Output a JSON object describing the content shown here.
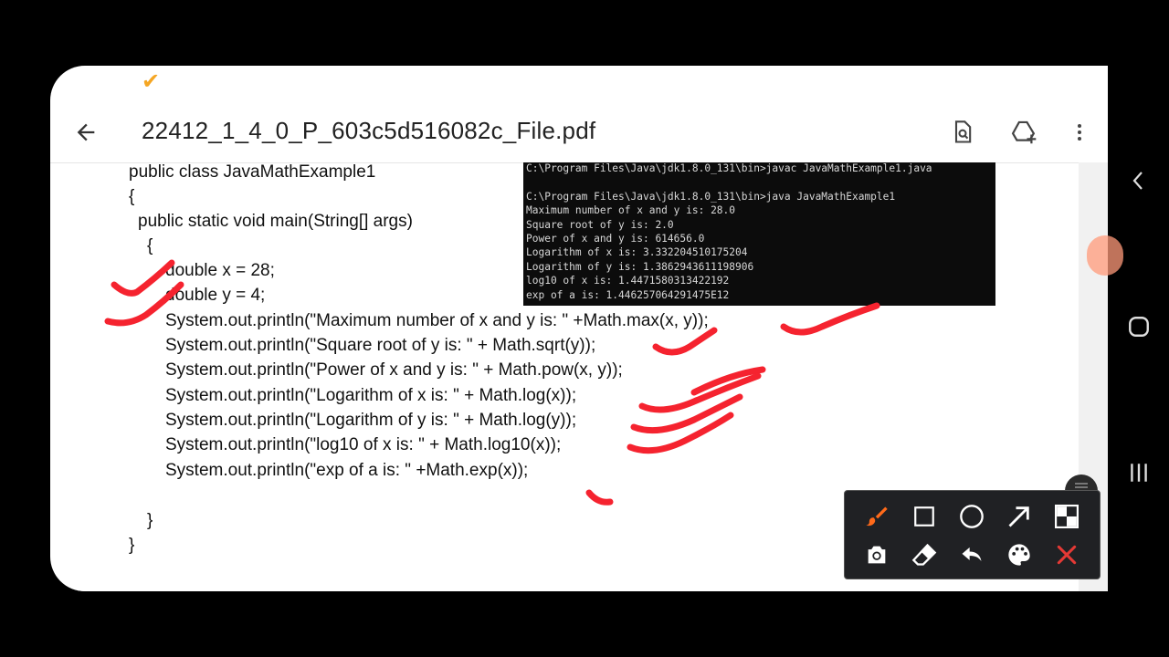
{
  "status_bar": {
    "check_icon": "checkmark-icon",
    "check_color": "#f5a623"
  },
  "app_bar": {
    "title": "22412_1_4_0_P_603c5d516082c_File.pdf",
    "back_icon": "arrow-left-icon",
    "actions": [
      "search-document-icon",
      "add-to-drive-icon",
      "more-vert-icon"
    ]
  },
  "document": {
    "code_lines": [
      "public class JavaMathExample1",
      "{",
      "public static void main(String[] args)",
      "{",
      "double x = 28;",
      "double y = 4;",
      "System.out.println(\"Maximum number of x and y is: \" +Math.max(x, y));",
      "System.out.println(\"Square root of y is: \" + Math.sqrt(y));",
      "System.out.println(\"Power of x and y is: \" + Math.pow(x, y));",
      "System.out.println(\"Logarithm of x is: \" + Math.log(x));",
      "System.out.println(\"Logarithm of y is: \" + Math.log(y));",
      "System.out.println(\"log10 of x is: \" + Math.log10(x));",
      "System.out.println(\"exp of a is: \" +Math.exp(x));",
      "}",
      "}"
    ],
    "terminal_lines": [
      "C:\\Program Files\\Java\\jdk1.8.0_131\\bin>javac JavaMathExample1.java",
      "",
      "C:\\Program Files\\Java\\jdk1.8.0_131\\bin>java JavaMathExample1",
      "Maximum number of x and y is: 28.0",
      "Square root of y is: 2.0",
      "Power of x and y is: 614656.0",
      "Logarithm of x is: 3.332204510175204",
      "Logarithm of y is: 1.3862943611198906",
      "log10 of x is: 1.4471580313422192",
      "exp of a is: 1.446257064291475E12"
    ]
  },
  "annotation": {
    "ink_color": "#f5232f"
  },
  "annotation_toolbar": {
    "row1": [
      "brush-icon",
      "rectangle-icon",
      "circle-icon",
      "arrow-icon",
      "mosaic-icon"
    ],
    "row2": [
      "camera-icon",
      "eraser-icon",
      "undo-icon",
      "palette-icon",
      "close-icon"
    ],
    "brush_color": "#ff6a1a",
    "close_color": "#e53935"
  },
  "system_nav": [
    "back-chevron-icon",
    "home-icon",
    "recents-icon"
  ]
}
